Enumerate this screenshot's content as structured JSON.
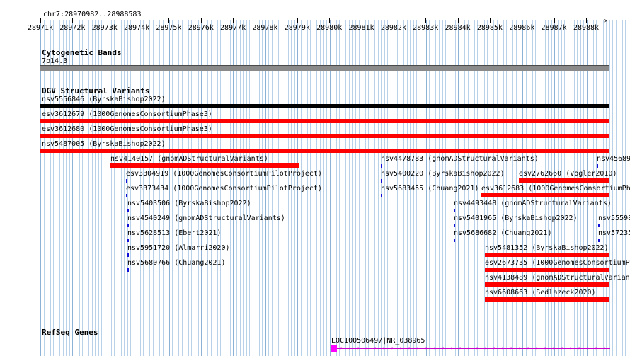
{
  "position": "chr7:28970982..28988583",
  "ruler": {
    "ticks": [
      "28971k",
      "28972k",
      "28973k",
      "28974k",
      "28975k",
      "28976k",
      "28977k",
      "28978k",
      "28979k",
      "28980k",
      "28981k",
      "28982k",
      "28983k",
      "28984k",
      "28985k",
      "28986k",
      "28987k",
      "28988k"
    ]
  },
  "cytoband": {
    "title": "Cytogenetic Bands",
    "band": "7p14.3"
  },
  "dgv": {
    "title": "DGV Structural Variants",
    "items": [
      {
        "label": "nsv5556846 (ByrskaBishop2022)",
        "color": "#000000",
        "type": "bar"
      },
      {
        "label": "esv3612679 (1000GenomesConsortiumPhase3)",
        "color": "#ff0000",
        "type": "bar"
      },
      {
        "label": "esv3612680 (1000GenomesConsortiumPhase3)",
        "color": "#ff0000",
        "type": "bar"
      },
      {
        "label": "nsv5487005 (ByrskaBishop2022)",
        "color": "#ff0000",
        "type": "bar"
      },
      {
        "label": "nsv4140157 (gnomADStructuralVariants)",
        "color": "#ff0000",
        "type": "bar"
      },
      {
        "label": "esv3304919 (1000GenomesConsortiumPilotProject)",
        "color": "#1010d8",
        "type": "tick"
      },
      {
        "label": "esv3373434 (1000GenomesConsortiumPilotProject)",
        "color": "#1010d8",
        "type": "tick"
      },
      {
        "label": "nsv5403506 (ByrskaBishop2022)",
        "color": "#1010d8",
        "type": "tick"
      },
      {
        "label": "nsv4540249 (gnomADStructuralVariants)",
        "color": "#1010d8",
        "type": "tick"
      },
      {
        "label": "nsv5628513 (Ebert2021)",
        "color": "#1010d8",
        "type": "tick"
      },
      {
        "label": "nsv5951720 (Almarri2020)",
        "color": "#1010d8",
        "type": "tick"
      },
      {
        "label": "nsv5680766 (Chuang2021)",
        "color": "#1010d8",
        "type": "tick"
      },
      {
        "label": "nsv4478783 (gnomADStructuralVariants)",
        "color": "#1010d8",
        "type": "tick"
      },
      {
        "label": "nsv5400220 (ByrskaBishop2022)",
        "color": "#1010d8",
        "type": "tick"
      },
      {
        "label": "nsv5683455 (Chuang2021)",
        "color": "#1010d8",
        "type": "tick"
      },
      {
        "label": "nsv45689",
        "color": "#1010d8",
        "type": "tick"
      },
      {
        "label": "esv2762660 (Vogler2010)",
        "color": "#ff0000",
        "type": "bar"
      },
      {
        "label": "esv3612683 (1000GenomesConsortiumPh",
        "color": "#ff0000",
        "type": "bar"
      },
      {
        "label": "nsv4493448 (gnomADStructuralVariants)",
        "color": "#1010d8",
        "type": "tick"
      },
      {
        "label": "nsv5401965 (ByrskaBishop2022)",
        "color": "#1010d8",
        "type": "tick"
      },
      {
        "label": "nsv5686682 (Chuang2021)",
        "color": "#1010d8",
        "type": "tick"
      },
      {
        "label": "nsv55598",
        "color": "#1010d8",
        "type": "tick"
      },
      {
        "label": "nsv57235",
        "color": "#1010d8",
        "type": "tick"
      },
      {
        "label": "nsv5481352 (ByrskaBishop2022)",
        "color": "#ff0000",
        "type": "bar"
      },
      {
        "label": "esv2673735 (1000GenomesConsortiumPl",
        "color": "#ff0000",
        "type": "bar"
      },
      {
        "label": "nsv4138489 (gnomADStructuralVarian",
        "color": "#ff0000",
        "type": "bar"
      },
      {
        "label": "nsv6608663 (Sedlazeck2020)",
        "color": "#ff0000",
        "type": "bar"
      }
    ]
  },
  "refseq": {
    "title": "RefSeq Genes",
    "gene_label": "LOC100506497|NR_038965",
    "color": "#ff00ff"
  }
}
